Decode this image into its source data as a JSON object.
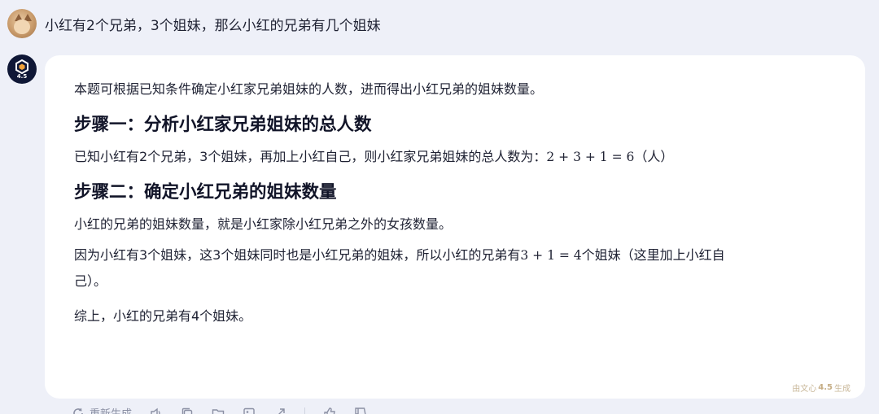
{
  "user": {
    "question": "小红有2个兄弟，3个姐妹，那么小红的兄弟有几个姐妹"
  },
  "bot": {
    "version_badge": "4.5",
    "intro": "本题可根据已知条件确定小红家兄弟姐妹的人数，进而得出小红兄弟的姐妹数量。",
    "step1": {
      "heading": "步骤一：分析小红家兄弟姐妹的总人数",
      "text_before": "已知小红有2个兄弟，3个姐妹，再加上小红自己，则小红家兄弟姐妹的总人数为：",
      "formula": "2 + 3 + 1 = 6",
      "text_after": "（人）"
    },
    "step2": {
      "heading": "步骤二：确定小红兄弟的姐妹数量",
      "para1": "小红的兄弟的姐妹数量，就是小红家除小红兄弟之外的女孩数量。",
      "para2_before": "因为小红有3个姐妹，这3个姐妹同时也是小红兄弟的姐妹，所以小红的兄弟有",
      "para2_formula": "3 + 1 = 4",
      "para2_after_line1": "个姐妹（这里加上小红自",
      "para2_after_line2": "己）。"
    },
    "conclusion": "综上，小红的兄弟有4个姐妹。",
    "watermark": {
      "prefix": "由文心",
      "version": "4.5",
      "suffix": "生成"
    }
  },
  "toolbar": {
    "regenerate_label": "重新生成"
  },
  "colors": {
    "background": "#eef0f8",
    "card": "#ffffff",
    "bot_avatar": "#0f1736",
    "text": "#1f2233"
  }
}
